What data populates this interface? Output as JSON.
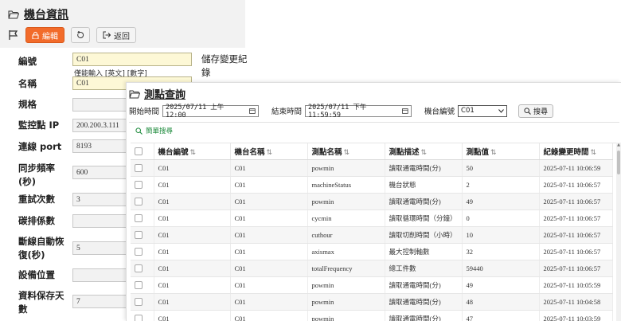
{
  "machine_info": {
    "title": "機台資訊",
    "toolbar": {
      "edit_label": "編輯",
      "back_label": "返回"
    },
    "fields": [
      {
        "label": "編號",
        "value": "C01",
        "hint": "僅能輸入 [英文] [數字]"
      },
      {
        "label": "名稱",
        "value": "C01"
      },
      {
        "label": "規格",
        "value": ""
      },
      {
        "label": "監控點 IP",
        "value": "200.200.3.111"
      },
      {
        "label": "連線 port",
        "value": "8193"
      },
      {
        "label": "同步頻率(秒)",
        "value": "600"
      },
      {
        "label": "重試次數",
        "value": "3"
      },
      {
        "label": "碳排係數",
        "value": ""
      },
      {
        "label": "斷線自動恢復(秒)",
        "value": "5"
      },
      {
        "label": "設備位置",
        "value": ""
      },
      {
        "label": "資料保存天數",
        "value": "7"
      }
    ],
    "save_change_label": "儲存變更紀錄"
  },
  "point_query": {
    "title": "測點查詢",
    "filters": {
      "start_label": "開始時間",
      "start_value": "2025/07/11 上午 12:00",
      "end_label": "結束時間",
      "end_value": "2025/07/11 下午 11:59:59",
      "machine_label": "機台編號",
      "machine_value": "C01",
      "search_label": "搜尋"
    },
    "simple_search_label": "簡單搜尋",
    "table": {
      "columns": [
        "機台編號",
        "機台名稱",
        "測點名稱",
        "測點描述",
        "測點值",
        "紀錄變更時間"
      ],
      "rows": [
        [
          "C01",
          "C01",
          "powmin",
          "讀取通電時間(分)",
          "50",
          "2025-07-11 10:06:59"
        ],
        [
          "C01",
          "C01",
          "machineStatus",
          "機台狀態",
          "2",
          "2025-07-11 10:06:57"
        ],
        [
          "C01",
          "C01",
          "powmin",
          "讀取通電時間(分)",
          "49",
          "2025-07-11 10:06:57"
        ],
        [
          "C01",
          "C01",
          "cycmin",
          "讀取循環時間（分鐘）",
          "0",
          "2025-07-11 10:06:57"
        ],
        [
          "C01",
          "C01",
          "cuthour",
          "讀取切削時間（小時）",
          "10",
          "2025-07-11 10:06:57"
        ],
        [
          "C01",
          "C01",
          "axismax",
          "最大控制軸數",
          "32",
          "2025-07-11 10:06:57"
        ],
        [
          "C01",
          "C01",
          "totalFrequency",
          "總工件數",
          "59440",
          "2025-07-11 10:06:57"
        ],
        [
          "C01",
          "C01",
          "powmin",
          "讀取通電時間(分)",
          "49",
          "2025-07-11 10:05:59"
        ],
        [
          "C01",
          "C01",
          "powmin",
          "讀取通電時間(分)",
          "48",
          "2025-07-11 10:04:58"
        ],
        [
          "C01",
          "C01",
          "powmin",
          "讀取通電時間(分)",
          "47",
          "2025-07-11 10:03:59"
        ]
      ]
    }
  },
  "colors": {
    "edit_button": "#f26b2a",
    "link_green": "#1c8a3b",
    "input_yellow": "#fdf8d6"
  }
}
